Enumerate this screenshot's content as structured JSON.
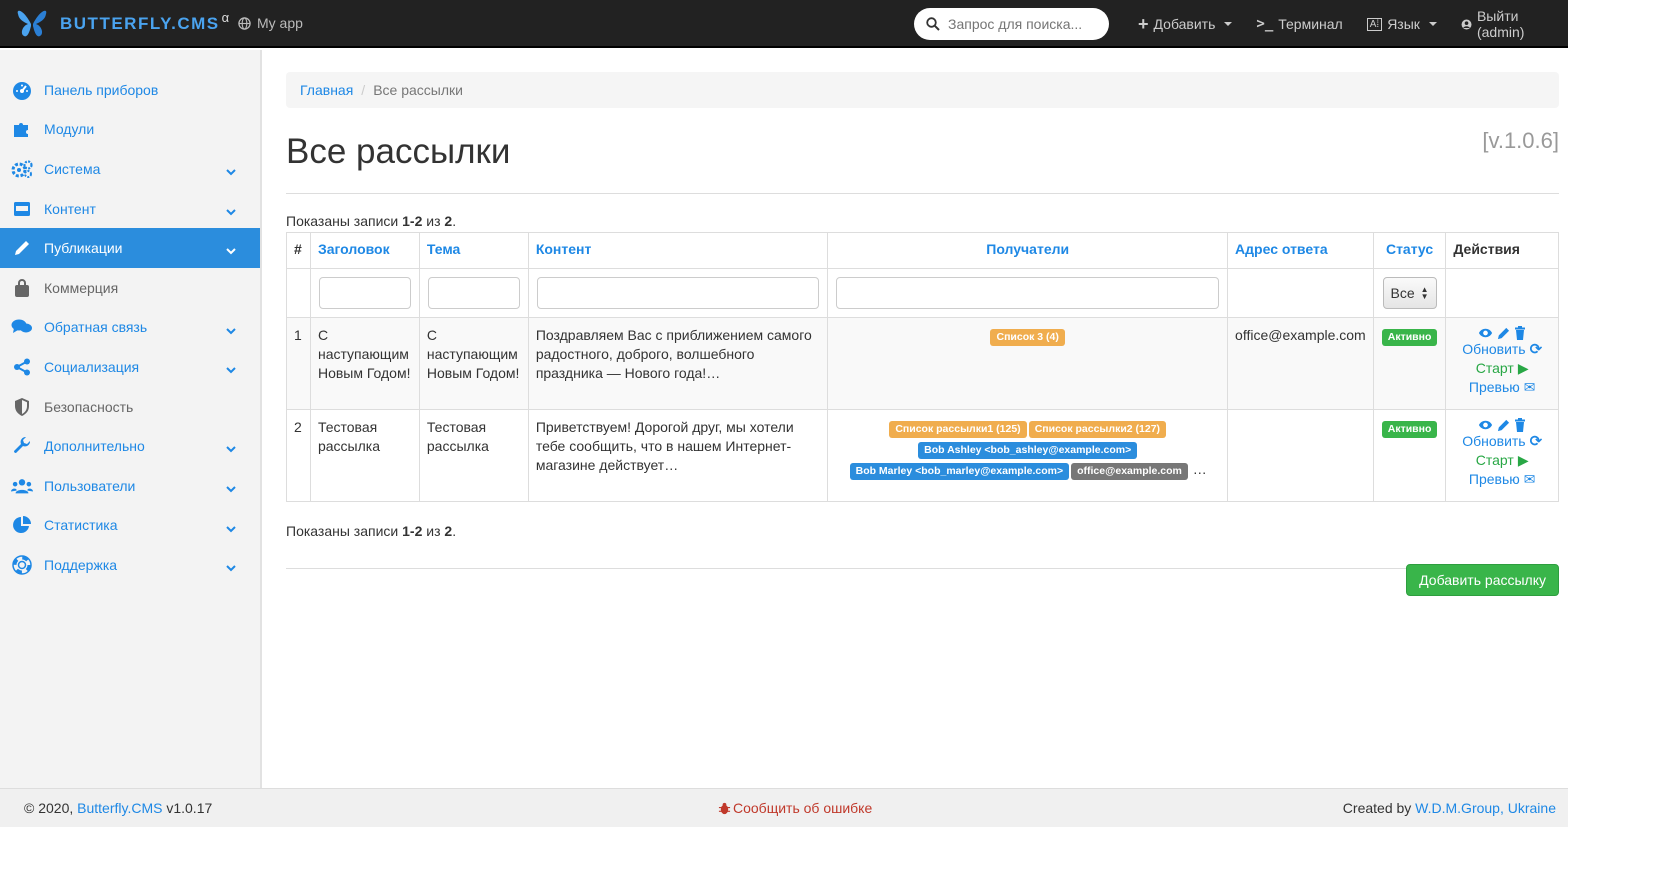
{
  "navbar": {
    "brand": "BUTTERFLY.CMS",
    "brand_sup": "α",
    "app": "My app",
    "search_placeholder": "Запрос для поиска...",
    "add": "Добавить",
    "terminal": "Терминал",
    "language": "Язык",
    "logout": "Выйти (admin)"
  },
  "sidebar": {
    "items": [
      {
        "label": "Панель приборов",
        "icon": "dashboard-icon"
      },
      {
        "label": "Модули",
        "icon": "puzzle-icon"
      },
      {
        "label": "Система",
        "icon": "cogs-icon"
      },
      {
        "label": "Контент",
        "icon": "inbox-icon"
      },
      {
        "label": "Публикации",
        "icon": "pencil-icon"
      },
      {
        "label": "Коммерция",
        "icon": "bag-icon"
      },
      {
        "label": "Обратная связь",
        "icon": "comments-icon"
      },
      {
        "label": "Социализация",
        "icon": "share-icon"
      },
      {
        "label": "Безопасность",
        "icon": "shield-icon"
      },
      {
        "label": "Дополнительно",
        "icon": "wrench-icon"
      },
      {
        "label": "Пользователи",
        "icon": "users-icon"
      },
      {
        "label": "Статистика",
        "icon": "pie-chart-icon"
      },
      {
        "label": "Поддержка",
        "icon": "lifebuoy-icon"
      }
    ]
  },
  "breadcrumb": {
    "home": "Главная",
    "current": "Все рассылки"
  },
  "page": {
    "title": "Все рассылки",
    "version": "[v.1.0.6]"
  },
  "summary": {
    "prefix": "Показаны записи ",
    "range": "1-2",
    "mid": " из ",
    "total": "2",
    "end": "."
  },
  "table": {
    "headers": {
      "num": "#",
      "title": "Заголовок",
      "subject": "Тема",
      "content": "Контент",
      "recipients": "Получатели",
      "reply": "Адрес ответа",
      "status": "Статус",
      "actions": "Действия"
    },
    "status_filter": "Все",
    "rows": [
      {
        "num": "1",
        "title": "С наступающим Новым Годом!",
        "subject": "С наступающим Новым Годом!",
        "content": "Поздравляем Вас с приближением самого радостного, доброго, волшебного праздника — Нового года!…",
        "recipients": [
          {
            "text": "Список 3 (4)",
            "kind": "warn"
          }
        ],
        "reply": "office@example.com",
        "status": "Активно"
      },
      {
        "num": "2",
        "title": "Тестовая рассылка",
        "subject": "Тестовая рассылка",
        "content": "Приветствуем! Дорогой друг, мы хотели тебе сообщить, что в нашем Интернет-магазине действует…",
        "recipients": [
          {
            "text": "Список рассылки1 (125)",
            "kind": "warn"
          },
          {
            "text": "Список рассылки2 (127)",
            "kind": "warn"
          },
          {
            "text": "Bob Ashley <bob_ashley@example.com>",
            "kind": "blue"
          },
          {
            "text": "Bob Marley <bob_marley@example.com>",
            "kind": "blue"
          },
          {
            "text": "office@example.com",
            "kind": "gray"
          }
        ],
        "recipients_more": "…",
        "reply": "",
        "status": "Активно"
      }
    ],
    "actions": {
      "update": "Обновить",
      "start": "Старт",
      "preview": "Превью"
    }
  },
  "add_button": "Добавить рассылку",
  "footer": {
    "copy": "© 2020, ",
    "cms_link": "Butterfly.CMS",
    "cms_version": " v1.0.17",
    "report": "Сообщить об ошибке",
    "created_prefix": "Created by ",
    "created_link": "W.D.M.Group, Ukraine"
  },
  "colors": {
    "accent": "#1e88e5",
    "active": "#2b8ddd",
    "success": "#39b54a",
    "warning": "#f0ad4e"
  }
}
